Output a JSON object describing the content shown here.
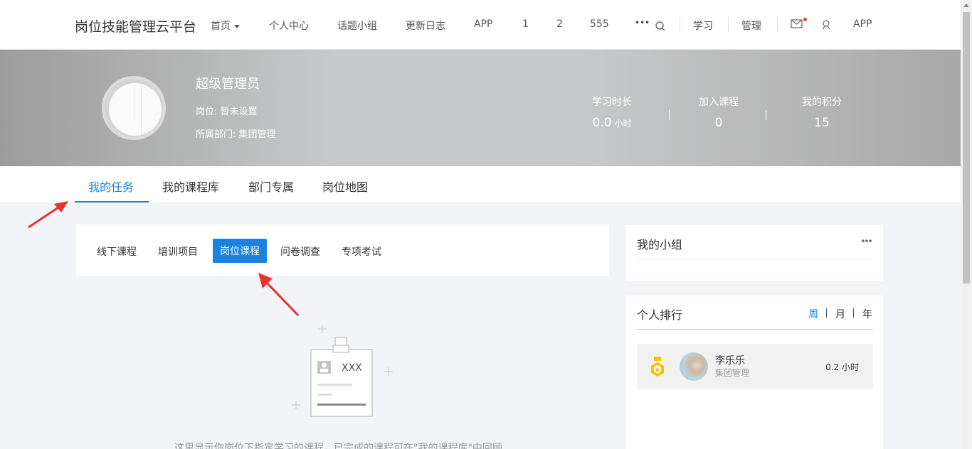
{
  "header": {
    "brand": "岗位技能管理云平台",
    "nav": [
      "首页",
      "个人中心",
      "话题小组",
      "更新日志",
      "APP",
      "1",
      "2",
      "555"
    ],
    "more": "•••",
    "right_links": [
      "学习",
      "管理"
    ],
    "app_label": "APP"
  },
  "profile": {
    "name": "超级管理员",
    "post": "岗位: 暂未设置",
    "department": "所属部门: 集团管理",
    "stats": [
      {
        "label": "学习时长",
        "value": "0.0",
        "unit": "小时"
      },
      {
        "label": "加入课程",
        "value": "0",
        "unit": ""
      },
      {
        "label": "我的积分",
        "value": "15",
        "unit": ""
      }
    ]
  },
  "tabs": [
    "我的任务",
    "我的课程库",
    "部门专属",
    "岗位地图"
  ],
  "subtabs": [
    "线下课程",
    "培训项目",
    "岗位课程",
    "问卷调查",
    "专项考试"
  ],
  "empty": {
    "card_text": "XXX",
    "message": "这里显示你岗位下指定学习的课程，已完成的课程可在\"我的课程库\"中回顾"
  },
  "sidebar": {
    "group_title": "我的小组",
    "rank_title": "个人排行",
    "periods": [
      "周",
      "月",
      "年"
    ],
    "ranking": [
      {
        "name": "李乐乐",
        "dept": "集团管理",
        "hours": "0.2 小时"
      }
    ]
  },
  "colors": {
    "accent": "#1a82e2",
    "annotation_arrow": "#e8332f",
    "medal": "#f5c400"
  }
}
